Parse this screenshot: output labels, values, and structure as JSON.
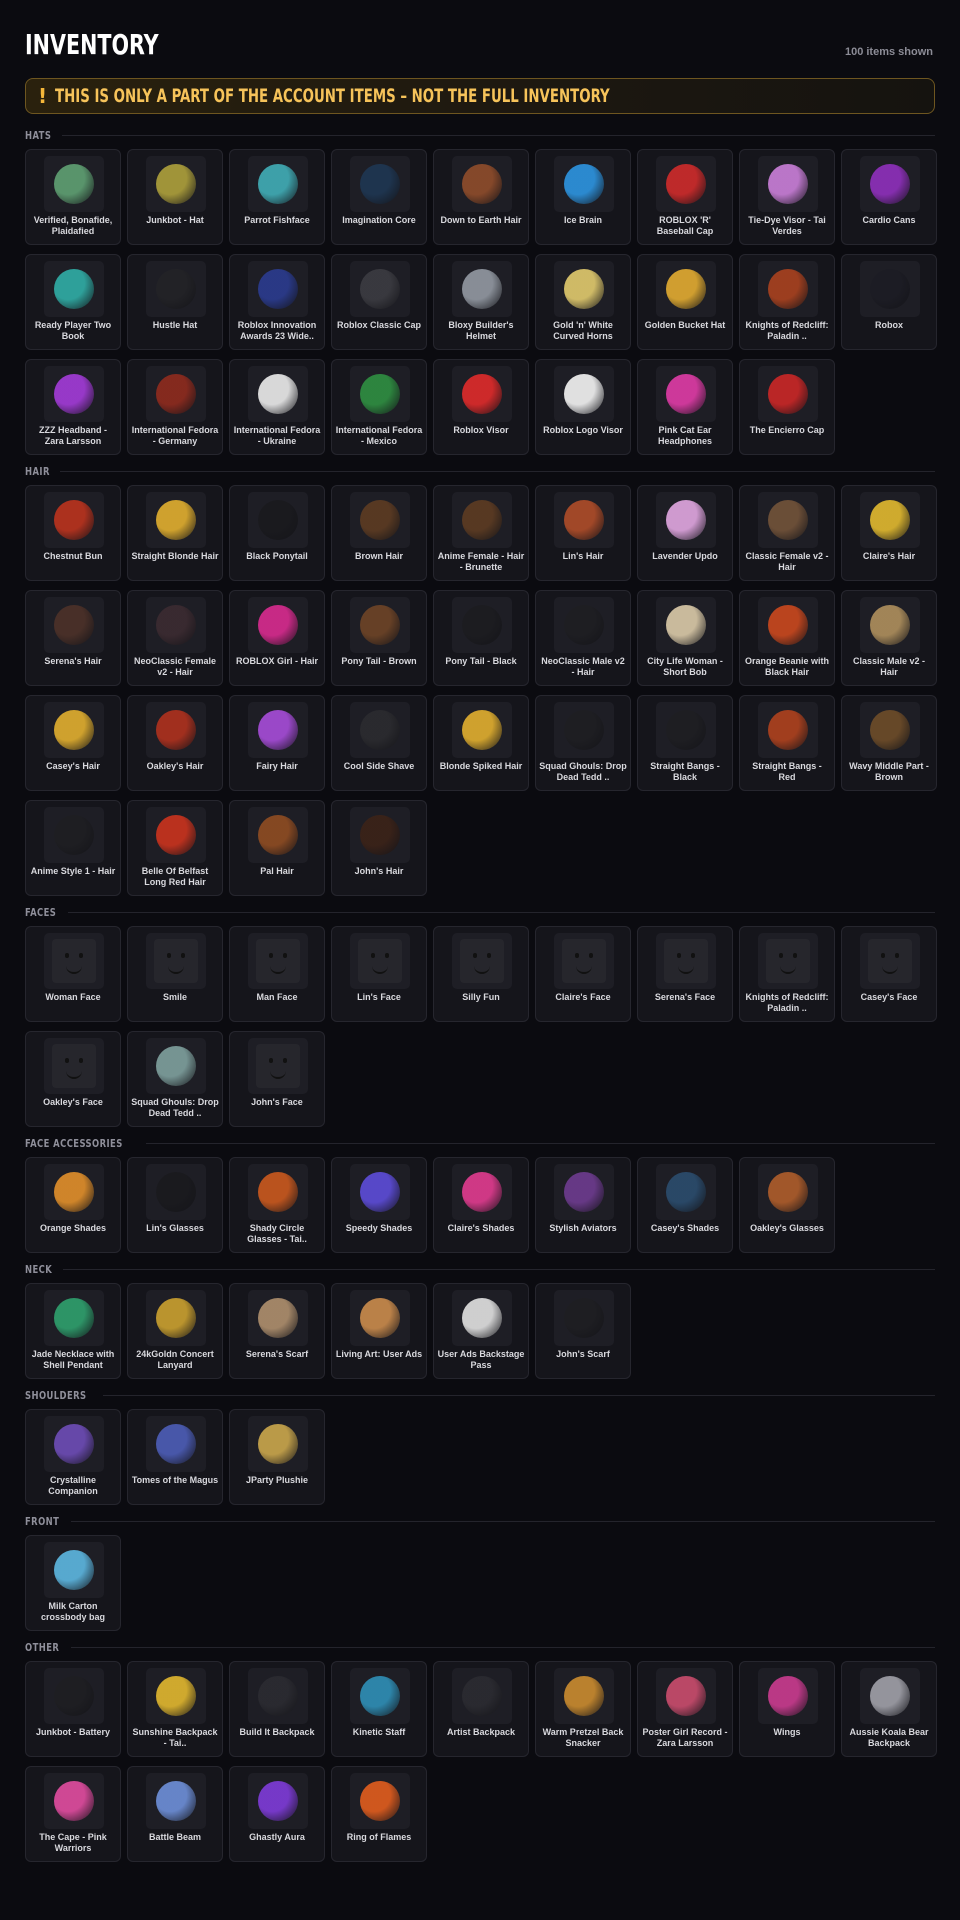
{
  "header": {
    "title": "INVENTORY",
    "count": "100 items shown"
  },
  "banner": {
    "icon": "!",
    "text": "THIS IS ONLY A PART OF THE ACCOUNT ITEMS – NOT THE FULL INVENTORY"
  },
  "sections": [
    {
      "label": "HATS",
      "items": [
        {
          "name": "Verified, Bonafide, Plaidafied",
          "icon": "plaid-cap-icon",
          "color": "#5c9a6f"
        },
        {
          "name": "Junkbot - Hat",
          "icon": "junkbot-hat-icon",
          "color": "#a79a3a"
        },
        {
          "name": "Parrot Fishface",
          "icon": "fish-icon",
          "color": "#3fa7b0"
        },
        {
          "name": "Imagination Core",
          "icon": "cube-icon",
          "color": "#1e3550"
        },
        {
          "name": "Down to Earth Hair",
          "icon": "hair-icon",
          "color": "#8a4a2a"
        },
        {
          "name": "Ice Brain",
          "icon": "ice-brain-icon",
          "color": "#2c8fd8"
        },
        {
          "name": "ROBLOX 'R' Baseball Cap",
          "icon": "baseball-cap-icon",
          "color": "#c62a2a"
        },
        {
          "name": "Tie-Dye Visor - Tai Verdes",
          "icon": "visor-icon",
          "color": "#c27ad0"
        },
        {
          "name": "Cardio Cans",
          "icon": "headphones-icon",
          "color": "#8a2fb5"
        },
        {
          "name": "Ready Player Two Book",
          "icon": "book-icon",
          "color": "#2fa7a0"
        },
        {
          "name": "Hustle Hat",
          "icon": "cap-icon",
          "color": "#222226"
        },
        {
          "name": "Roblox Innovation Awards 23 Wide..",
          "icon": "crown-icon",
          "color": "#2a3a8a"
        },
        {
          "name": "Roblox Classic Cap",
          "icon": "cap-icon",
          "color": "#3a3a40"
        },
        {
          "name": "Bloxy Builder's Helmet",
          "icon": "helmet-icon",
          "color": "#8d939c"
        },
        {
          "name": "Gold 'n' White Curved Horns",
          "icon": "horns-icon",
          "color": "#d8c26a"
        },
        {
          "name": "Golden Bucket Hat",
          "icon": "bucket-hat-icon",
          "color": "#d9a530"
        },
        {
          "name": "Knights of Redcliff: Paladin ..",
          "icon": "knight-helmet-icon",
          "color": "#a3401f"
        },
        {
          "name": "Robox",
          "icon": "robox-icon",
          "color": "#1c1c24"
        },
        {
          "name": "ZZZ Headband - Zara Larsson",
          "icon": "headband-icon",
          "color": "#9d3ad0"
        },
        {
          "name": "International Fedora - Germany",
          "icon": "fedora-icon",
          "color": "#8a2a1e"
        },
        {
          "name": "International Fedora - Ukraine",
          "icon": "fedora-icon",
          "color": "#e2e2e2"
        },
        {
          "name": "International Fedora - Mexico",
          "icon": "fedora-icon",
          "color": "#2e8a40"
        },
        {
          "name": "Roblox Visor",
          "icon": "visor-icon",
          "color": "#d62a2a"
        },
        {
          "name": "Roblox Logo Visor",
          "icon": "visor-icon",
          "color": "#eaeaea"
        },
        {
          "name": "Pink Cat Ear Headphones",
          "icon": "cat-headphones-icon",
          "color": "#d63aa0"
        },
        {
          "name": "The Encierro Cap",
          "icon": "cap-icon",
          "color": "#c22626"
        }
      ]
    },
    {
      "label": "HAIR",
      "items": [
        {
          "name": "Chestnut Bun",
          "icon": "hair-icon",
          "color": "#b4321e"
        },
        {
          "name": "Straight Blonde Hair",
          "icon": "hair-icon",
          "color": "#d8a82e"
        },
        {
          "name": "Black Ponytail",
          "icon": "hair-icon",
          "color": "#1a1a1e"
        },
        {
          "name": "Brown Hair",
          "icon": "hair-icon",
          "color": "#5a3a22"
        },
        {
          "name": "Anime Female - Hair - Brunette",
          "icon": "hair-icon",
          "color": "#5a3a22"
        },
        {
          "name": "Lin's Hair",
          "icon": "hair-icon",
          "color": "#a84a28"
        },
        {
          "name": "Lavender Updo",
          "icon": "hair-icon",
          "color": "#d8a0d8"
        },
        {
          "name": "Classic Female v2 - Hair",
          "icon": "hair-icon",
          "color": "#6e5038"
        },
        {
          "name": "Claire's Hair",
          "icon": "hair-icon",
          "color": "#d8b22e"
        },
        {
          "name": "Serena's Hair",
          "icon": "hair-icon",
          "color": "#4a3028"
        },
        {
          "name": "NeoClassic Female v2 - Hair",
          "icon": "hair-icon",
          "color": "#3a2a30"
        },
        {
          "name": "ROBLOX Girl - Hair",
          "icon": "hair-icon",
          "color": "#d02a8a"
        },
        {
          "name": "Pony Tail - Brown",
          "icon": "hair-icon",
          "color": "#6a4226"
        },
        {
          "name": "Pony Tail - Black",
          "icon": "hair-icon",
          "color": "#1c1c20"
        },
        {
          "name": "NeoClassic Male v2 - Hair",
          "icon": "hair-icon",
          "color": "#1e1e22"
        },
        {
          "name": "City Life Woman - Short Bob",
          "icon": "hair-icon",
          "color": "#d2c2a2"
        },
        {
          "name": "Orange Beanie with Black Hair",
          "icon": "beanie-icon",
          "color": "#c2461e"
        },
        {
          "name": "Classic Male v2 - Hair",
          "icon": "hair-icon",
          "color": "#a88a5a"
        },
        {
          "name": "Casey's Hair",
          "icon": "hair-icon",
          "color": "#d8a82e"
        },
        {
          "name": "Oakley's Hair",
          "icon": "hair-icon",
          "color": "#a8301e"
        },
        {
          "name": "Fairy Hair",
          "icon": "hair-icon",
          "color": "#a04ad0"
        },
        {
          "name": "Cool Side Shave",
          "icon": "hair-icon",
          "color": "#2a2a2e"
        },
        {
          "name": "Blonde Spiked Hair",
          "icon": "hair-icon",
          "color": "#d8a82e"
        },
        {
          "name": "Squad Ghouls: Drop Dead Tedd ..",
          "icon": "hair-icon",
          "color": "#1e1e22"
        },
        {
          "name": "Straight Bangs - Black",
          "icon": "hair-icon",
          "color": "#1e1e22"
        },
        {
          "name": "Straight Bangs - Red",
          "icon": "hair-icon",
          "color": "#a8401e"
        },
        {
          "name": "Wavy Middle Part - Brown",
          "icon": "hair-icon",
          "color": "#6a4a28"
        },
        {
          "name": "Anime Style 1 - Hair",
          "icon": "hair-icon",
          "color": "#1e1e22"
        },
        {
          "name": "Belle Of Belfast Long Red Hair",
          "icon": "hair-icon",
          "color": "#c2321e"
        },
        {
          "name": "Pal Hair",
          "icon": "hair-icon",
          "color": "#8a4a22"
        },
        {
          "name": "John's Hair",
          "icon": "hair-icon",
          "color": "#3a2218"
        }
      ]
    },
    {
      "label": "FACES",
      "items": [
        {
          "name": "Woman Face",
          "icon": "face-icon",
          "color": "#26262c"
        },
        {
          "name": "Smile",
          "icon": "face-icon",
          "color": "#26262c"
        },
        {
          "name": "Man Face",
          "icon": "face-icon",
          "color": "#26262c"
        },
        {
          "name": "Lin's Face",
          "icon": "face-icon",
          "color": "#26262c"
        },
        {
          "name": "Silly Fun",
          "icon": "face-icon",
          "color": "#26262c"
        },
        {
          "name": "Claire's Face",
          "icon": "face-icon",
          "color": "#26262c"
        },
        {
          "name": "Serena's Face",
          "icon": "face-icon",
          "color": "#26262c"
        },
        {
          "name": "Knights of Redcliff: Paladin ..",
          "icon": "face-icon",
          "color": "#26262c"
        },
        {
          "name": "Casey's Face",
          "icon": "face-icon",
          "color": "#26262c"
        },
        {
          "name": "Oakley's Face",
          "icon": "face-icon",
          "color": "#26262c"
        },
        {
          "name": "Squad Ghouls: Drop Dead Tedd ..",
          "icon": "ghoul-face-icon",
          "color": "#7a9a98"
        },
        {
          "name": "John's Face",
          "icon": "face-icon",
          "color": "#26262c"
        }
      ]
    },
    {
      "label": "FACE ACCESSORIES",
      "items": [
        {
          "name": "Orange Shades",
          "icon": "sunglasses-icon",
          "color": "#d88a2a"
        },
        {
          "name": "Lin's Glasses",
          "icon": "glasses-icon",
          "color": "#1a1a1e"
        },
        {
          "name": "Shady Circle Glasses - Tai..",
          "icon": "glasses-icon",
          "color": "#c2561e"
        },
        {
          "name": "Speedy Shades",
          "icon": "shutter-shades-icon",
          "color": "#5a4ad0"
        },
        {
          "name": "Claire's Shades",
          "icon": "sunglasses-icon",
          "color": "#d83a8a"
        },
        {
          "name": "Stylish Aviators",
          "icon": "aviators-icon",
          "color": "#6a3a8a"
        },
        {
          "name": "Casey's Shades",
          "icon": "sunglasses-icon",
          "color": "#2a4a6a"
        },
        {
          "name": "Oakley's Glasses",
          "icon": "glasses-icon",
          "color": "#a85a2a"
        }
      ]
    },
    {
      "label": "NECK",
      "items": [
        {
          "name": "Jade Necklace with Shell Pendant",
          "icon": "necklace-icon",
          "color": "#2e9a6a"
        },
        {
          "name": "24kGoldn Concert Lanyard",
          "icon": "lanyard-icon",
          "color": "#c29a2e"
        },
        {
          "name": "Serena's Scarf",
          "icon": "scarf-icon",
          "color": "#a88a6a"
        },
        {
          "name": "Living Art: User Ads",
          "icon": "frame-icon",
          "color": "#c2864a"
        },
        {
          "name": "User Ads Backstage Pass",
          "icon": "pass-icon",
          "color": "#d8d8d8"
        },
        {
          "name": "John's Scarf",
          "icon": "scarf-icon",
          "color": "#1e1e22"
        }
      ]
    },
    {
      "label": "SHOULDERS",
      "items": [
        {
          "name": "Crystalline Companion",
          "icon": "companion-icon",
          "color": "#6a4ab0"
        },
        {
          "name": "Tomes of the Magus",
          "icon": "books-icon",
          "color": "#4a5ab0"
        },
        {
          "name": "JParty Plushie",
          "icon": "plushie-icon",
          "color": "#c2a04a"
        }
      ]
    },
    {
      "label": "FRONT",
      "items": [
        {
          "name": "Milk Carton crossbody bag",
          "icon": "milk-bag-icon",
          "color": "#5ab0d8"
        }
      ]
    },
    {
      "label": "OTHER",
      "items": [
        {
          "name": "Junkbot - Battery",
          "icon": "battery-icon",
          "color": "#1e1e22"
        },
        {
          "name": "Sunshine Backpack - Tai..",
          "icon": "sun-icon",
          "color": "#d8b02e"
        },
        {
          "name": "Build It Backpack",
          "icon": "backpack-icon",
          "color": "#2a2a30"
        },
        {
          "name": "Kinetic Staff",
          "icon": "staff-icon",
          "color": "#2e8ab0"
        },
        {
          "name": "Artist Backpack",
          "icon": "backpack-icon",
          "color": "#2a2a30"
        },
        {
          "name": "Warm Pretzel Back Snacker",
          "icon": "pretzel-icon",
          "color": "#c2862e"
        },
        {
          "name": "Poster Girl Record - Zara Larsson",
          "icon": "record-icon",
          "color": "#c24a6a"
        },
        {
          "name": "Wings",
          "icon": "butterfly-wings-icon",
          "color": "#c23a8a"
        },
        {
          "name": "Aussie Koala Bear Backpack",
          "icon": "koala-icon",
          "color": "#9a9aa2"
        },
        {
          "name": "The Cape - Pink Warriors",
          "icon": "cape-icon",
          "color": "#d84a9a"
        },
        {
          "name": "Battle Beam",
          "icon": "beam-icon",
          "color": "#6a8ad0"
        },
        {
          "name": "Ghastly Aura",
          "icon": "aura-icon",
          "color": "#7a3ad0"
        },
        {
          "name": "Ring of Flames",
          "icon": "flames-icon",
          "color": "#d85a1e"
        }
      ]
    }
  ]
}
